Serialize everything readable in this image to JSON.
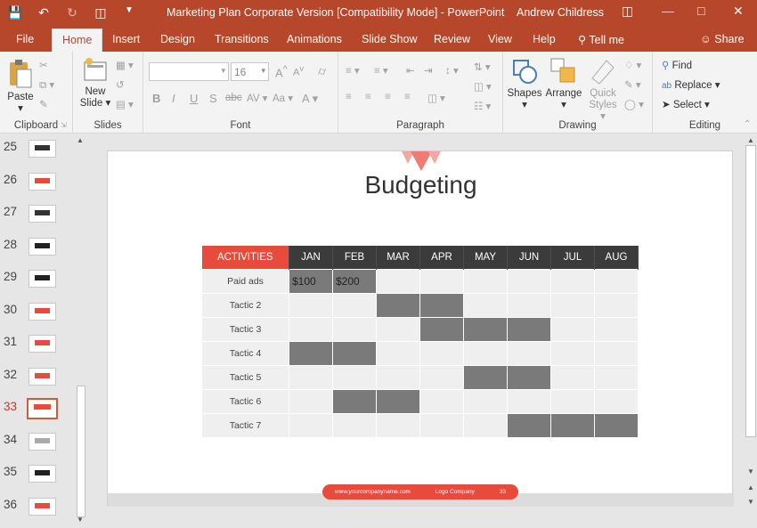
{
  "titlebar": {
    "document_title": "Marketing Plan Corporate Version [Compatibility Mode]  -  PowerPoint",
    "user_name": "Andrew Childress"
  },
  "tabs": [
    "File",
    "Home",
    "Insert",
    "Design",
    "Transitions",
    "Animations",
    "Slide Show",
    "Review",
    "View",
    "Help"
  ],
  "tell_me": "Tell me",
  "share": "Share",
  "ribbon": {
    "clipboard": {
      "paste": "Paste",
      "label": "Clipboard"
    },
    "slides": {
      "new_slide_1": "New",
      "new_slide_2": "Slide",
      "label": "Slides"
    },
    "font": {
      "font_name": "",
      "font_size": "16",
      "label": "Font"
    },
    "paragraph": {
      "label": "Paragraph"
    },
    "drawing": {
      "shapes": "Shapes",
      "arrange": "Arrange",
      "quick_styles_1": "Quick",
      "quick_styles_2": "Styles",
      "label": "Drawing"
    },
    "editing": {
      "find": "Find",
      "replace": "Replace",
      "select": "Select",
      "label": "Editing"
    }
  },
  "thumbnails": [
    {
      "num": "25"
    },
    {
      "num": "26"
    },
    {
      "num": "27"
    },
    {
      "num": "28"
    },
    {
      "num": "29"
    },
    {
      "num": "30"
    },
    {
      "num": "31"
    },
    {
      "num": "32"
    },
    {
      "num": "33",
      "selected": true
    },
    {
      "num": "34"
    },
    {
      "num": "35"
    },
    {
      "num": "36"
    }
  ],
  "slide": {
    "title": "Budgeting",
    "table": {
      "header": "ACTIVITIES",
      "months": [
        "JAN",
        "FEB",
        "MAR",
        "APR",
        "MAY",
        "JUN",
        "JUL",
        "AUG"
      ],
      "rows": [
        {
          "label": "Paid ads",
          "active": [
            0,
            1
          ],
          "values": [
            "$100",
            "$200",
            "",
            "",
            "",
            "",
            "",
            ""
          ]
        },
        {
          "label": "Tactic 2",
          "active": [
            2,
            3
          ],
          "values": [
            "",
            "",
            "",
            "",
            "",
            "",
            "",
            ""
          ]
        },
        {
          "label": "Tactic 3",
          "active": [
            3,
            4,
            5
          ],
          "values": [
            "",
            "",
            "",
            "",
            "",
            "",
            "",
            ""
          ]
        },
        {
          "label": "Tactic 4",
          "active": [
            0,
            1
          ],
          "values": [
            "",
            "",
            "",
            "",
            "",
            "",
            "",
            ""
          ]
        },
        {
          "label": "Tactic 5",
          "active": [
            4,
            5
          ],
          "values": [
            "",
            "",
            "",
            "",
            "",
            "",
            "",
            ""
          ]
        },
        {
          "label": "Tactic 6",
          "active": [
            1,
            2
          ],
          "values": [
            "",
            "",
            "",
            "",
            "",
            "",
            "",
            ""
          ]
        },
        {
          "label": "Tactic 7",
          "active": [
            5,
            6,
            7
          ],
          "values": [
            "",
            "",
            "",
            "",
            "",
            "",
            "",
            ""
          ]
        }
      ]
    },
    "footer": {
      "website": "www.yourcompanyname.com",
      "logo": "Logo Company",
      "page": "33"
    }
  },
  "colors": {
    "accent": "#b7472a",
    "slide_red": "#e84b3b",
    "table_header": "#3b3b3b",
    "cell_active": "#7a7a7a"
  }
}
